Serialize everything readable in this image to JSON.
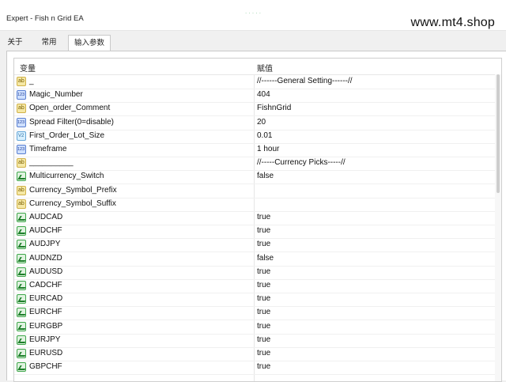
{
  "window": {
    "title": "Expert - Fish n Grid EA",
    "watermark": "www.mt4.shop"
  },
  "tabs": [
    {
      "label": "关于"
    },
    {
      "label": "常用"
    },
    {
      "label": "输入参数"
    }
  ],
  "grid": {
    "headers": {
      "variable": "变量",
      "value": "赋值"
    },
    "rows": [
      {
        "icon": "ab",
        "name": "_",
        "value": "//------General Setting------//"
      },
      {
        "icon": "n123",
        "name": "Magic_Number",
        "value": "404"
      },
      {
        "icon": "ab",
        "name": "Open_order_Comment",
        "value": "FishnGrid"
      },
      {
        "icon": "n123",
        "name": "Spread Filter(0=disable)",
        "value": "20"
      },
      {
        "icon": "va",
        "name": "First_Order_Lot_Size",
        "value": "0.01"
      },
      {
        "icon": "n123",
        "name": "Timeframe",
        "value": "1 hour"
      },
      {
        "icon": "ab",
        "name": "__________",
        "value": "//-----Currency Picks-----//"
      },
      {
        "icon": "bool",
        "name": "Multicurrency_Switch",
        "value": "false"
      },
      {
        "icon": "ab",
        "name": "Currency_Symbol_Prefix",
        "value": ""
      },
      {
        "icon": "ab",
        "name": "Currency_Symbol_Suffix",
        "value": ""
      },
      {
        "icon": "bool",
        "name": "AUDCAD",
        "value": "true"
      },
      {
        "icon": "bool",
        "name": "AUDCHF",
        "value": "true"
      },
      {
        "icon": "bool",
        "name": "AUDJPY",
        "value": "true"
      },
      {
        "icon": "bool",
        "name": "AUDNZD",
        "value": "false"
      },
      {
        "icon": "bool",
        "name": "AUDUSD",
        "value": "true"
      },
      {
        "icon": "bool",
        "name": "CADCHF",
        "value": "true"
      },
      {
        "icon": "bool",
        "name": "EURCAD",
        "value": "true"
      },
      {
        "icon": "bool",
        "name": "EURCHF",
        "value": "true"
      },
      {
        "icon": "bool",
        "name": "EURGBP",
        "value": "true"
      },
      {
        "icon": "bool",
        "name": "EURJPY",
        "value": "true"
      },
      {
        "icon": "bool",
        "name": "EURUSD",
        "value": "true"
      },
      {
        "icon": "bool",
        "name": "GBPCHF",
        "value": "true"
      }
    ]
  }
}
